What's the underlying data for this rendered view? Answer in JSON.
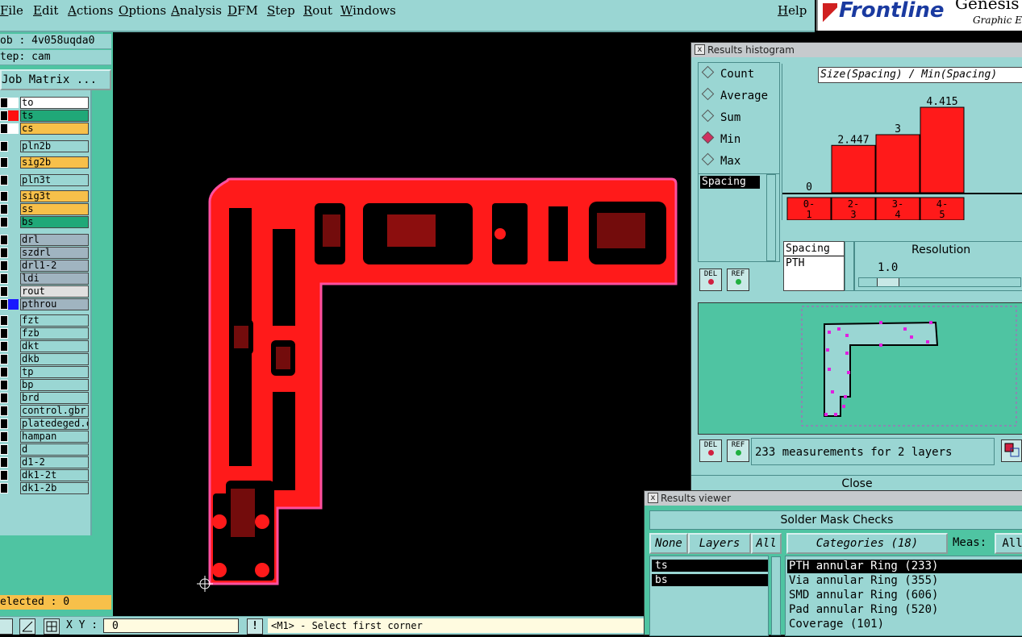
{
  "menubar": {
    "items": [
      "File",
      "Edit",
      "Actions",
      "Options",
      "Analysis",
      "DFM",
      "Step",
      "Rout",
      "Windows"
    ],
    "help": "Help"
  },
  "logo": {
    "brand": "Frontline",
    "product": "Genesis",
    "tagline": "Graphic E"
  },
  "job": {
    "job_label": "ob : 4v058uqda0",
    "step_label": "tep: cam",
    "matrix_button": "Job Matrix ..."
  },
  "layers": [
    {
      "name": "to",
      "color": "#ffffff",
      "swatch": "#ffffff"
    },
    {
      "name": "ts",
      "color": "#20a878",
      "swatch": "#ff1010"
    },
    {
      "name": "cs",
      "color": "#f7c04a",
      "swatch": "#ffffff"
    },
    {
      "name": "pln2b",
      "color": "#9ad6d3",
      "swatch": "#9ad6d3"
    },
    {
      "name": "sig2b",
      "color": "#f7c04a",
      "swatch": "#9ad6d3"
    },
    {
      "name": "pln3t",
      "color": "#9ad6d3",
      "swatch": "#9ad6d3"
    },
    {
      "name": "sig3t",
      "color": "#f7c04a",
      "swatch": "#9ad6d3"
    },
    {
      "name": "ss",
      "color": "#f7c04a",
      "swatch": "#9ad6d3"
    },
    {
      "name": "bs",
      "color": "#20a878",
      "swatch": "#9ad6d3"
    },
    {
      "name": "drl",
      "color": "#a0b4c0",
      "swatch": "#9ad6d3"
    },
    {
      "name": "szdrl",
      "color": "#a0b4c0",
      "swatch": "#9ad6d3"
    },
    {
      "name": "drl1-2",
      "color": "#a0b4c0",
      "swatch": "#9ad6d3"
    },
    {
      "name": "ldi",
      "color": "#a0b4c0",
      "swatch": "#9ad6d3"
    },
    {
      "name": "rout",
      "color": "#e0e0e0",
      "swatch": "#9ad6d3"
    },
    {
      "name": "pthrou",
      "color": "#a0b4c0",
      "swatch": "#1818ff"
    },
    {
      "name": "fzt",
      "color": "#9ad6d3",
      "swatch": "#9ad6d3"
    },
    {
      "name": "fzb",
      "color": "#9ad6d3",
      "swatch": "#9ad6d3"
    },
    {
      "name": "dkt",
      "color": "#9ad6d3",
      "swatch": "#9ad6d3"
    },
    {
      "name": "dkb",
      "color": "#9ad6d3",
      "swatch": "#9ad6d3"
    },
    {
      "name": "tp",
      "color": "#9ad6d3",
      "swatch": "#9ad6d3"
    },
    {
      "name": "bp",
      "color": "#9ad6d3",
      "swatch": "#9ad6d3"
    },
    {
      "name": "brd",
      "color": "#9ad6d3",
      "swatch": "#9ad6d3"
    },
    {
      "name": "control.gbr",
      "color": "#9ad6d3",
      "swatch": "#9ad6d3"
    },
    {
      "name": "platedeged.c",
      "color": "#9ad6d3",
      "swatch": "#9ad6d3"
    },
    {
      "name": "hampan",
      "color": "#9ad6d3",
      "swatch": "#9ad6d3"
    },
    {
      "name": "d",
      "color": "#9ad6d3",
      "swatch": "#9ad6d3"
    },
    {
      "name": "d1-2",
      "color": "#9ad6d3",
      "swatch": "#9ad6d3"
    },
    {
      "name": "dk1-2t",
      "color": "#9ad6d3",
      "swatch": "#9ad6d3"
    },
    {
      "name": "dk1-2b",
      "color": "#9ad6d3",
      "swatch": "#9ad6d3"
    }
  ],
  "selected_label": "elected : 0",
  "statusbar": {
    "xy_label": "X Y :",
    "xy_value": "0",
    "prompt": "<M1> - Select first corner",
    "bang": "!"
  },
  "histogram": {
    "window_title": "Results histogram",
    "modes": [
      {
        "label": "Count",
        "selected": false
      },
      {
        "label": "Average",
        "selected": false
      },
      {
        "label": "Sum",
        "selected": false
      },
      {
        "label": "Min",
        "selected": true
      },
      {
        "label": "Max",
        "selected": false
      }
    ],
    "measure_list": [
      "Spacing"
    ],
    "category_list": [
      "Spacing",
      "PTH"
    ],
    "resolution_label": "Resolution",
    "resolution_value": "1.0",
    "del_label": "DEL",
    "ref_label": "REF",
    "measurements_text": "233 measurements for 2 layers",
    "close_label": "Close"
  },
  "chart_data": {
    "type": "bar",
    "title": "Size(Spacing) / Min(Spacing)",
    "categories": [
      "0-\n1",
      "2-\n3",
      "3-\n4",
      "4-\n5"
    ],
    "category_labels_top": [
      "0-",
      "2-",
      "3-",
      "4-"
    ],
    "category_labels_bottom": [
      "1",
      "3",
      "4",
      "5"
    ],
    "values": [
      0,
      2.447,
      3,
      4.415
    ],
    "value_labels": [
      "0",
      "2.447",
      "3",
      "4.415"
    ],
    "ylim": [
      0,
      5
    ],
    "bar_color": "#ff1a1a"
  },
  "viewer": {
    "window_title": "Results viewer",
    "heading": "Solder Mask Checks",
    "none_label": "None",
    "layers_label": "Layers",
    "all_label": "All",
    "categories_label": "Categories (18)",
    "meas_label": "Meas:",
    "meas_all_label": "All",
    "layers": [
      "ts",
      "bs"
    ],
    "categories": [
      "PTH annular Ring (233)",
      "Via annular Ring (355)",
      "SMD annular Ring (606)",
      "Pad annular Ring (520)",
      "Coverage (101)"
    ]
  }
}
